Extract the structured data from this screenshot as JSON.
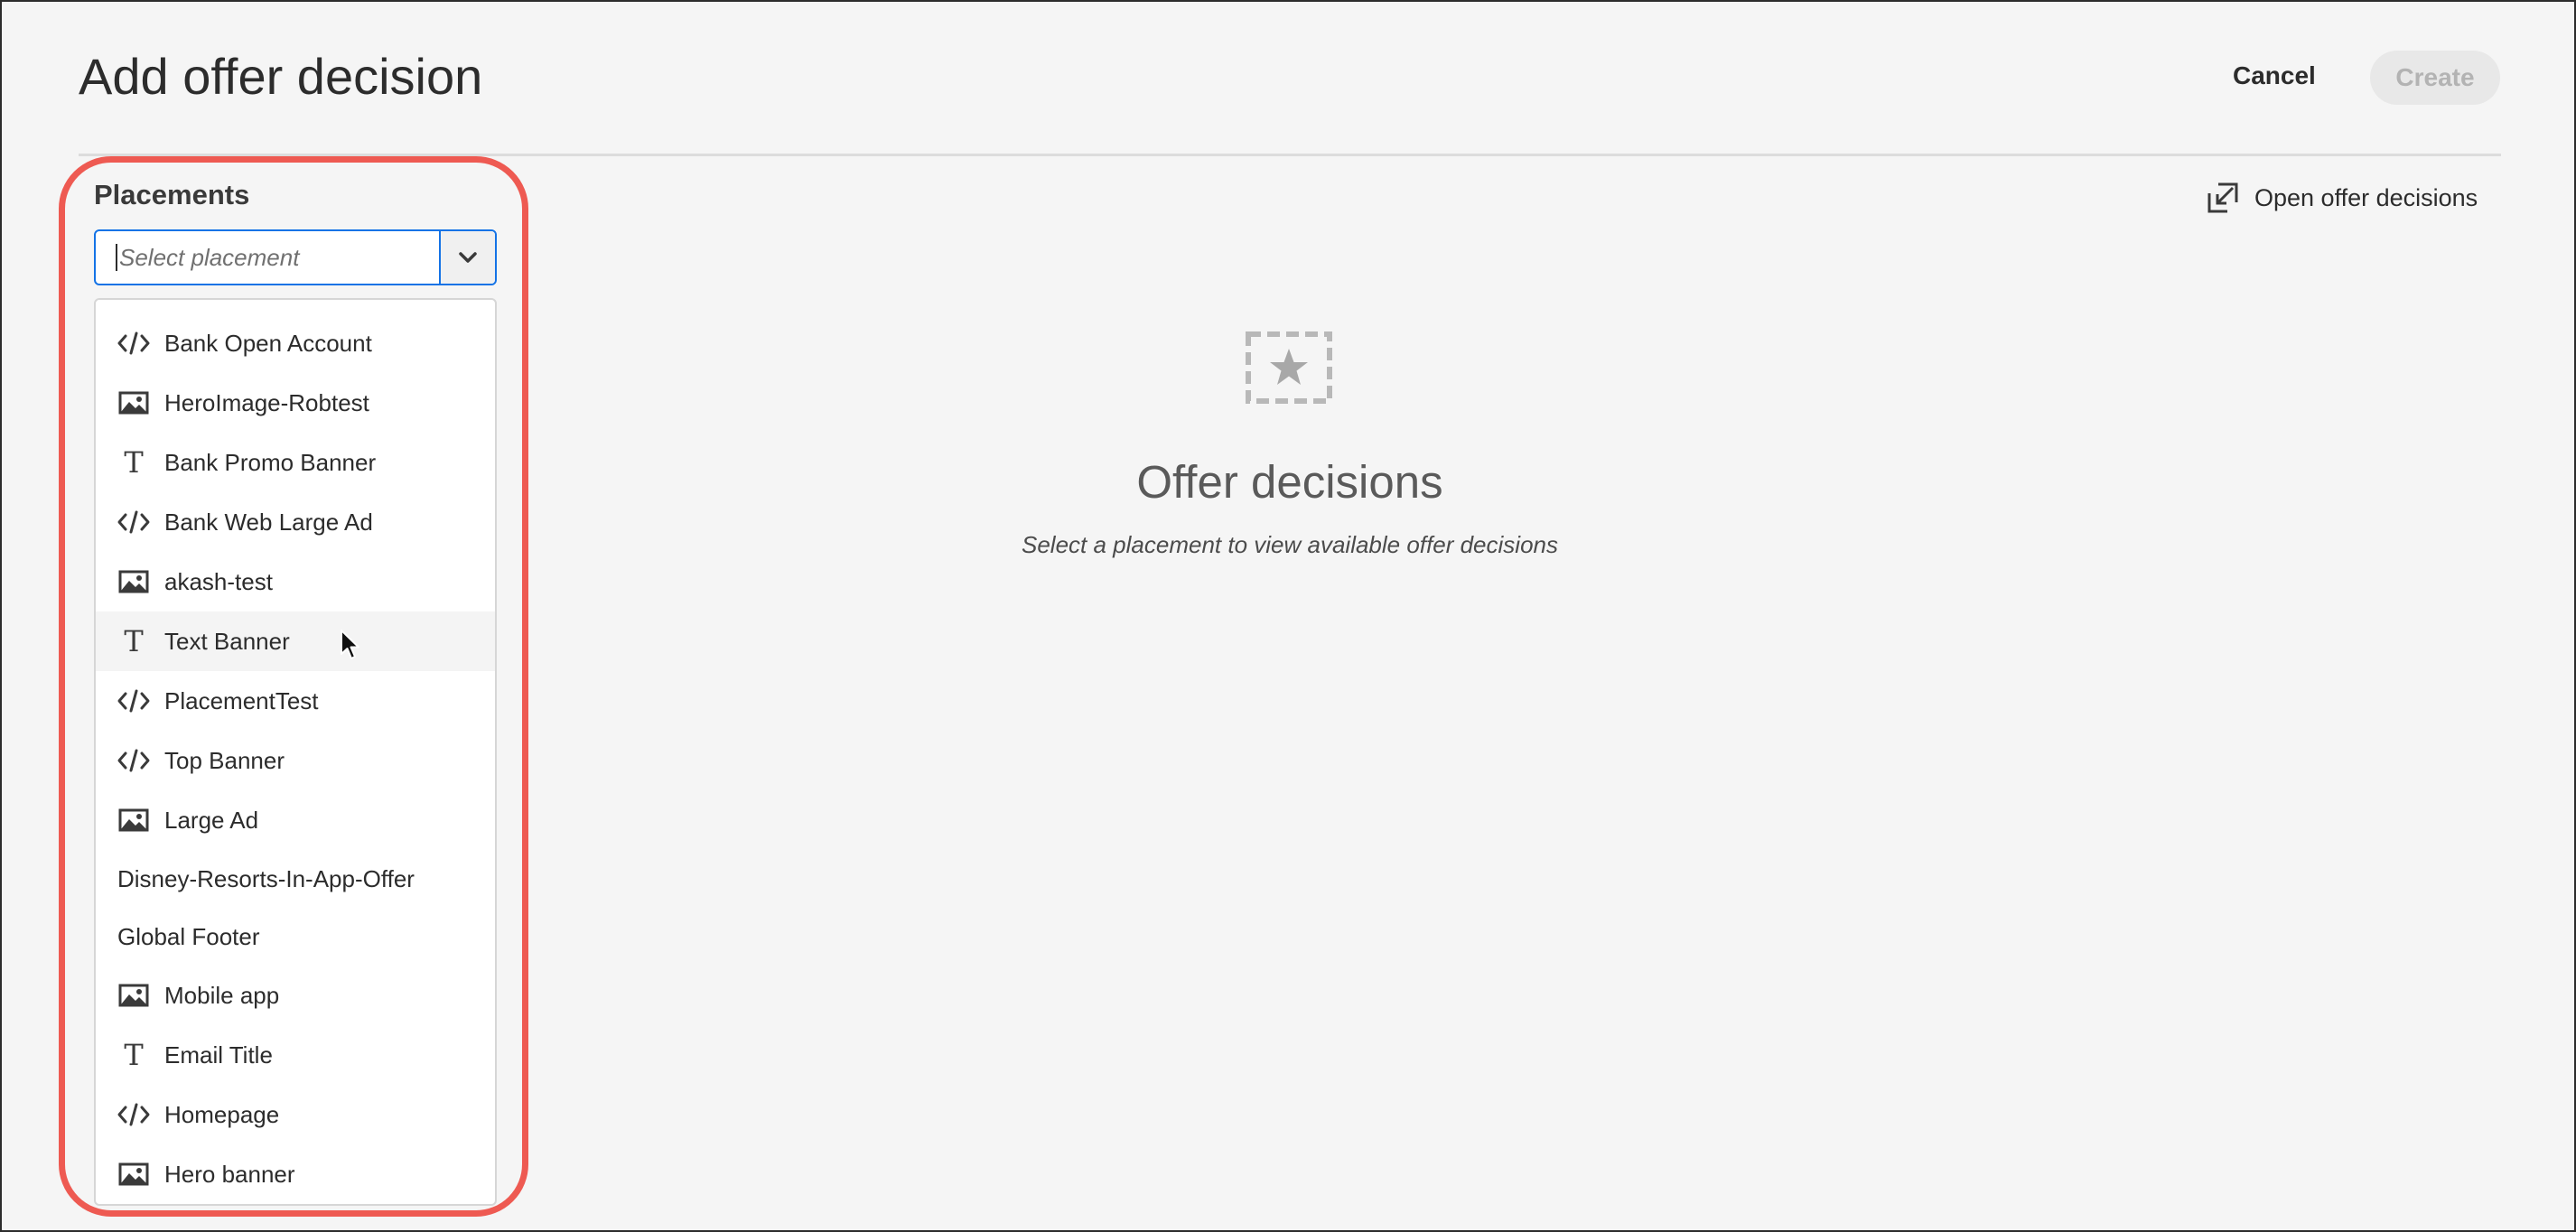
{
  "header": {
    "title": "Add offer decision",
    "cancel_label": "Cancel",
    "create_label": "Create"
  },
  "placements": {
    "label": "Placements",
    "placeholder": "Select placement",
    "options": [
      {
        "label": "Bank Open Account",
        "icon": "code-icon"
      },
      {
        "label": "HeroImage-Robtest",
        "icon": "image-icon"
      },
      {
        "label": "Bank Promo Banner",
        "icon": "text-icon"
      },
      {
        "label": "Bank Web Large Ad",
        "icon": "code-icon"
      },
      {
        "label": "akash-test",
        "icon": "image-icon"
      },
      {
        "label": "Text Banner",
        "icon": "text-icon"
      },
      {
        "label": "PlacementTest",
        "icon": "code-icon"
      },
      {
        "label": "Top Banner",
        "icon": "code-icon"
      },
      {
        "label": "Large Ad",
        "icon": "image-icon"
      },
      {
        "label": "Disney-Resorts-In-App-Offer",
        "icon": ""
      },
      {
        "label": "Global Footer",
        "icon": ""
      },
      {
        "label": "Mobile app",
        "icon": "image-icon"
      },
      {
        "label": "Email Title",
        "icon": "text-icon"
      },
      {
        "label": "Homepage",
        "icon": "code-icon"
      },
      {
        "label": "Hero banner",
        "icon": "image-icon"
      }
    ],
    "hovered_option": "Text Banner"
  },
  "panel": {
    "open_link_label": "Open offer decisions",
    "empty_title": "Offer decisions",
    "empty_subtitle": "Select a placement to view available offer decisions"
  },
  "colors": {
    "accent": "#1473e6",
    "highlight": "#ee5a52",
    "create_disabled_bg": "#e8e8e8"
  }
}
